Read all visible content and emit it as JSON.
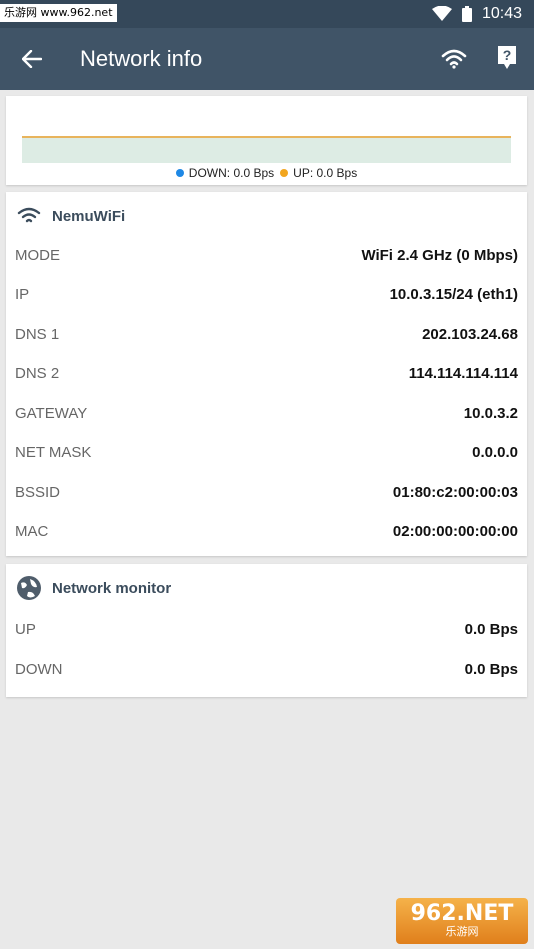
{
  "status_bar": {
    "watermark": "乐游网 www.962.net",
    "time": "10:43"
  },
  "app_bar": {
    "title": "Network info",
    "back_icon": "arrow-left-icon",
    "wifi_icon": "wifi-icon",
    "help_icon": "help-icon"
  },
  "chart_data": {
    "type": "area",
    "series": [
      {
        "name": "DOWN: 0.0 Bps",
        "color": "#1e88e5",
        "values": [
          0,
          0
        ]
      },
      {
        "name": "UP: 0.0 Bps",
        "color": "#f2a61f",
        "values": [
          0,
          0
        ]
      }
    ],
    "legend": "bottom"
  },
  "wifi_card": {
    "icon": "wifi-icon",
    "title": "NemuWiFi",
    "rows": [
      {
        "key": "MODE",
        "value": "WiFi 2.4 GHz (0 Mbps)"
      },
      {
        "key": "IP",
        "value": "10.0.3.15/24 (eth1)"
      },
      {
        "key": "DNS 1",
        "value": "202.103.24.68"
      },
      {
        "key": "DNS 2",
        "value": "114.114.114.114"
      },
      {
        "key": "GATEWAY",
        "value": "10.0.3.2"
      },
      {
        "key": "NET MASK",
        "value": "0.0.0.0"
      },
      {
        "key": "BSSID",
        "value": "01:80:c2:00:00:03"
      },
      {
        "key": "MAC",
        "value": "02:00:00:00:00:00"
      }
    ]
  },
  "monitor_card": {
    "icon": "globe-icon",
    "title": "Network monitor",
    "rows": [
      {
        "key": "UP",
        "value": "0.0 Bps"
      },
      {
        "key": "DOWN",
        "value": "0.0 Bps"
      }
    ]
  },
  "watermark_bottom": {
    "main": "962.NET",
    "sub": "乐游网"
  },
  "colors": {
    "status_bar": "#35485a",
    "app_bar": "#405467",
    "background": "#e9e9e9",
    "chart_fill": "#ddece4"
  }
}
